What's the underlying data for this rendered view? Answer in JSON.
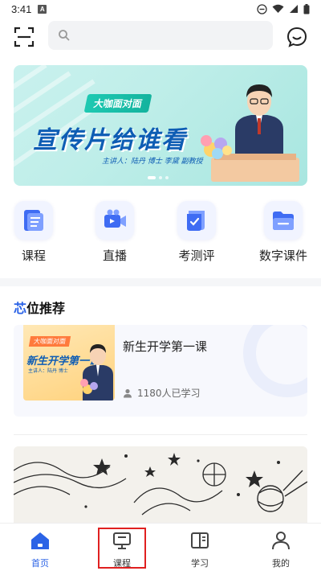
{
  "status_bar": {
    "time": "3:41",
    "badge": "A"
  },
  "search": {
    "placeholder": ""
  },
  "banner": {
    "tag": "大咖面对面",
    "headline": "宣传片给谁看",
    "speakers": "主讲人：陆丹 博士   李黛 副教授",
    "page_count": 3,
    "active_page": 1
  },
  "quick_links": [
    {
      "label": "课程",
      "icon": "course-book-icon"
    },
    {
      "label": "直播",
      "icon": "live-video-icon"
    },
    {
      "label": "考测评",
      "icon": "exam-icon"
    },
    {
      "label": "数字课件",
      "icon": "folder-icon"
    }
  ],
  "recommend": {
    "title_accent": "芯",
    "title_rest": "位推荐",
    "course": {
      "title": "新生开学第一课",
      "learners": "1180人已学习",
      "thumb_tag": "大咖面对面",
      "thumb_title": "新生开学第一课",
      "thumb_sub": "主讲人：陆丹 博士"
    }
  },
  "bottom_nav": [
    {
      "label": "首页",
      "icon": "home-icon",
      "active": true
    },
    {
      "label": "课程",
      "icon": "course-screen-icon",
      "active": false
    },
    {
      "label": "学习",
      "icon": "study-book-icon",
      "active": false
    },
    {
      "label": "我的",
      "icon": "profile-icon",
      "active": false
    }
  ],
  "colors": {
    "accent": "#2b63e6",
    "highlight": "#e02020"
  }
}
